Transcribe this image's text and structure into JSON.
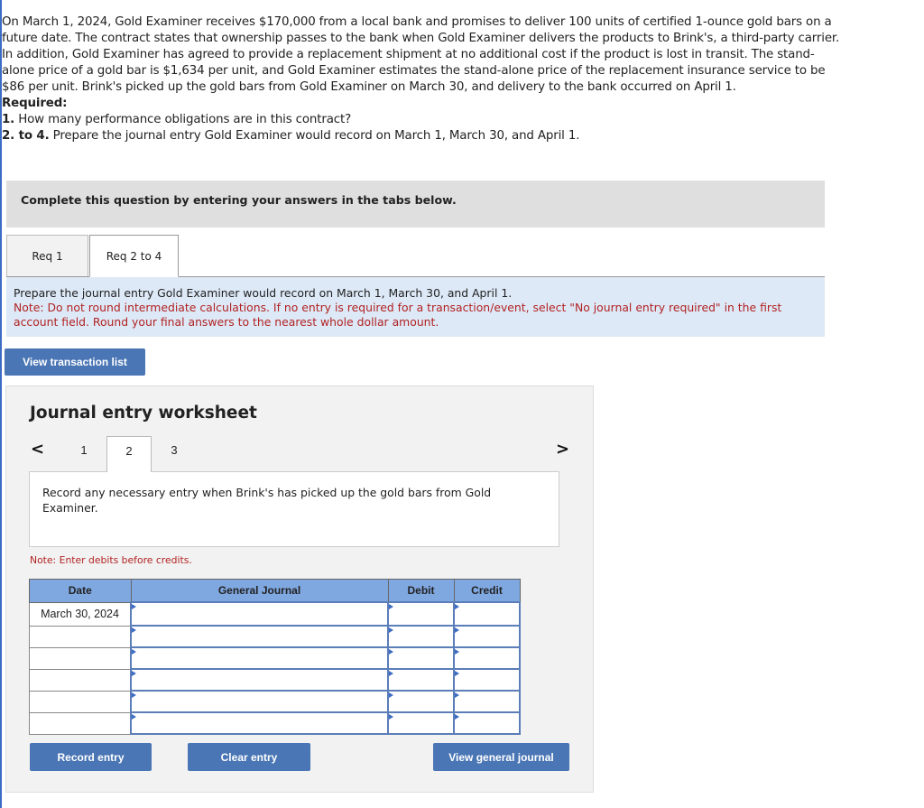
{
  "problem": {
    "paragraph": "On March 1, 2024, Gold Examiner receives $170,000 from a local bank and promises to deliver 100 units of certified 1-ounce gold bars on a future date. The contract states that ownership passes to the bank when Gold Examiner delivers the products to Brink's, a third-party carrier. In addition, Gold Examiner has agreed to provide a replacement shipment at no additional cost if the product is lost in transit. The stand-alone price of a gold bar is $1,634 per unit, and Gold Examiner estimates the stand-alone price of the replacement insurance service to be $86 per unit. Brink's picked up the gold bars from Gold Examiner on March 30, and delivery to the bank occurred on April 1.",
    "required_label": "Required:",
    "requirements": [
      {
        "num": "1.",
        "text": " How many performance obligations are in this contract?"
      },
      {
        "num": "2. to 4.",
        "text": " Prepare the journal entry Gold Examiner would record on March 1, March 30, and April 1."
      }
    ]
  },
  "instruction_bar": "Complete this question by entering your answers in the tabs below.",
  "tabs": [
    {
      "label": "Req 1",
      "active": false
    },
    {
      "label": "Req 2 to 4",
      "active": true
    }
  ],
  "tab_panel": {
    "prompt": "Prepare the journal entry Gold Examiner would record on March 1, March 30, and April 1.",
    "note": "Note: Do not round intermediate calculations. If no entry is required for a transaction/event, select \"No journal entry required\" in the first account field. Round your final answers to the nearest whole dollar amount."
  },
  "buttons": {
    "view_transaction_list": "View transaction list",
    "record_entry": "Record entry",
    "clear_entry": "Clear entry",
    "view_general_journal": "View general journal"
  },
  "worksheet": {
    "title": "Journal entry worksheet",
    "prev_icon": "<",
    "next_icon": ">",
    "steps": [
      "1",
      "2",
      "3"
    ],
    "active_step": "2",
    "description": "Record any necessary entry when Brink's has picked up the gold bars from Gold Examiner.",
    "note": "Note: Enter debits before credits.",
    "table": {
      "headers": {
        "date": "Date",
        "account": "General Journal",
        "debit": "Debit",
        "credit": "Credit"
      },
      "rows": [
        {
          "date": "March 30, 2024",
          "account": "",
          "debit": "",
          "credit": ""
        },
        {
          "date": "",
          "account": "",
          "debit": "",
          "credit": ""
        },
        {
          "date": "",
          "account": "",
          "debit": "",
          "credit": ""
        },
        {
          "date": "",
          "account": "",
          "debit": "",
          "credit": ""
        },
        {
          "date": "",
          "account": "",
          "debit": "",
          "credit": ""
        },
        {
          "date": "",
          "account": "",
          "debit": "",
          "credit": ""
        }
      ]
    }
  }
}
